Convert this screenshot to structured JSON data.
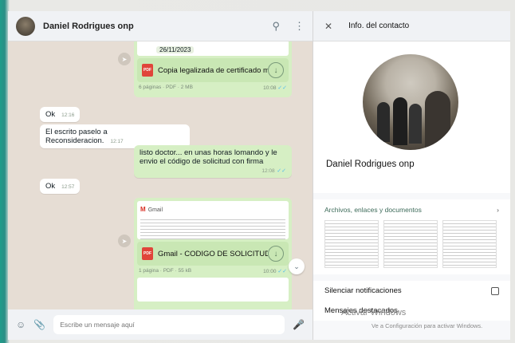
{
  "chat": {
    "contact_name": "Daniel Rodrigues onp",
    "date_chip": "26/11/2023",
    "doc1": {
      "title": "Copia legalizada de certificado me...",
      "meta": "6 páginas · PDF · 2 MB",
      "time": "10:08"
    },
    "messages": [
      {
        "text": "Ok",
        "time": "12:16"
      },
      {
        "text": "El escrito paselo a Reconsideracion.",
        "time": "12:17"
      },
      {
        "text": "listo doctor... en unas horas lomando y le envio el código de solicitud con firma",
        "time": "12:08"
      },
      {
        "text": "Ok",
        "time": "12:57"
      }
    ],
    "gmail_label": "Gmail",
    "doc2": {
      "title": "Gmail - CODIGO DE SOLICITUD N...",
      "meta": "1 página · PDF · 55 kB",
      "time": "10:00"
    },
    "composer_placeholder": "Escribe un mensaje aquí"
  },
  "info": {
    "title": "Info. del contacto",
    "contact_name": "Daniel Rodrigues onp",
    "media_label": "Archivos, enlaces y documentos",
    "mute_label": "Silenciar notificaciones",
    "starred_label": "Mensajes destacados"
  },
  "watermark": {
    "title": "Activar Windows",
    "subtitle": "Ve a Configuración para activar Windows."
  },
  "icons": [
    "search-icon",
    "more-icon",
    "close-icon",
    "chevron-right-icon",
    "emoji-icon",
    "attach-icon",
    "mic-icon",
    "download-icon",
    "share-icon",
    "chevron-down-icon"
  ]
}
